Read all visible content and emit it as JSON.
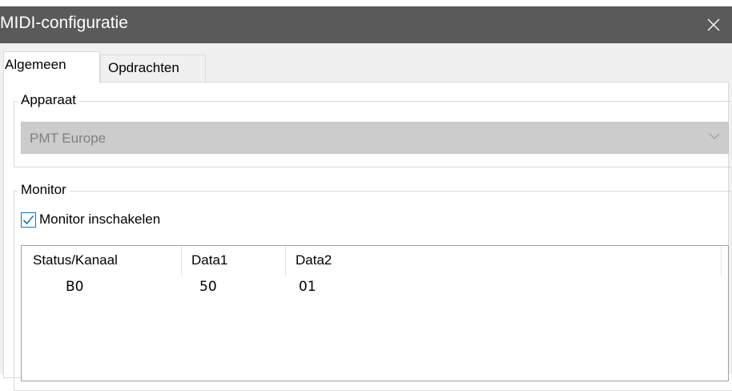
{
  "window": {
    "title": "MIDI-configuratie"
  },
  "tabs": [
    {
      "label": "Algemeen",
      "active": true
    },
    {
      "label": "Opdrachten",
      "active": false
    }
  ],
  "device_group": {
    "legend": "Apparaat",
    "select": {
      "value": "PMT Europe",
      "disabled": true
    }
  },
  "monitor_group": {
    "legend": "Monitor",
    "enable_checkbox": {
      "label": "Monitor inschakelen",
      "checked": true
    },
    "list": {
      "columns": [
        "Status/Kanaal",
        "Data1",
        "Data2"
      ],
      "rows": [
        [
          "B0",
          "50",
          "01"
        ]
      ]
    }
  },
  "colors": {
    "titlebar_bg": "#5a5a5a",
    "accent": "#0078d7",
    "disabled_select_bg": "#cccccc"
  },
  "icons": {
    "close": "close-icon",
    "dropdown": "chevron-down-icon",
    "check": "checkmark-icon"
  }
}
